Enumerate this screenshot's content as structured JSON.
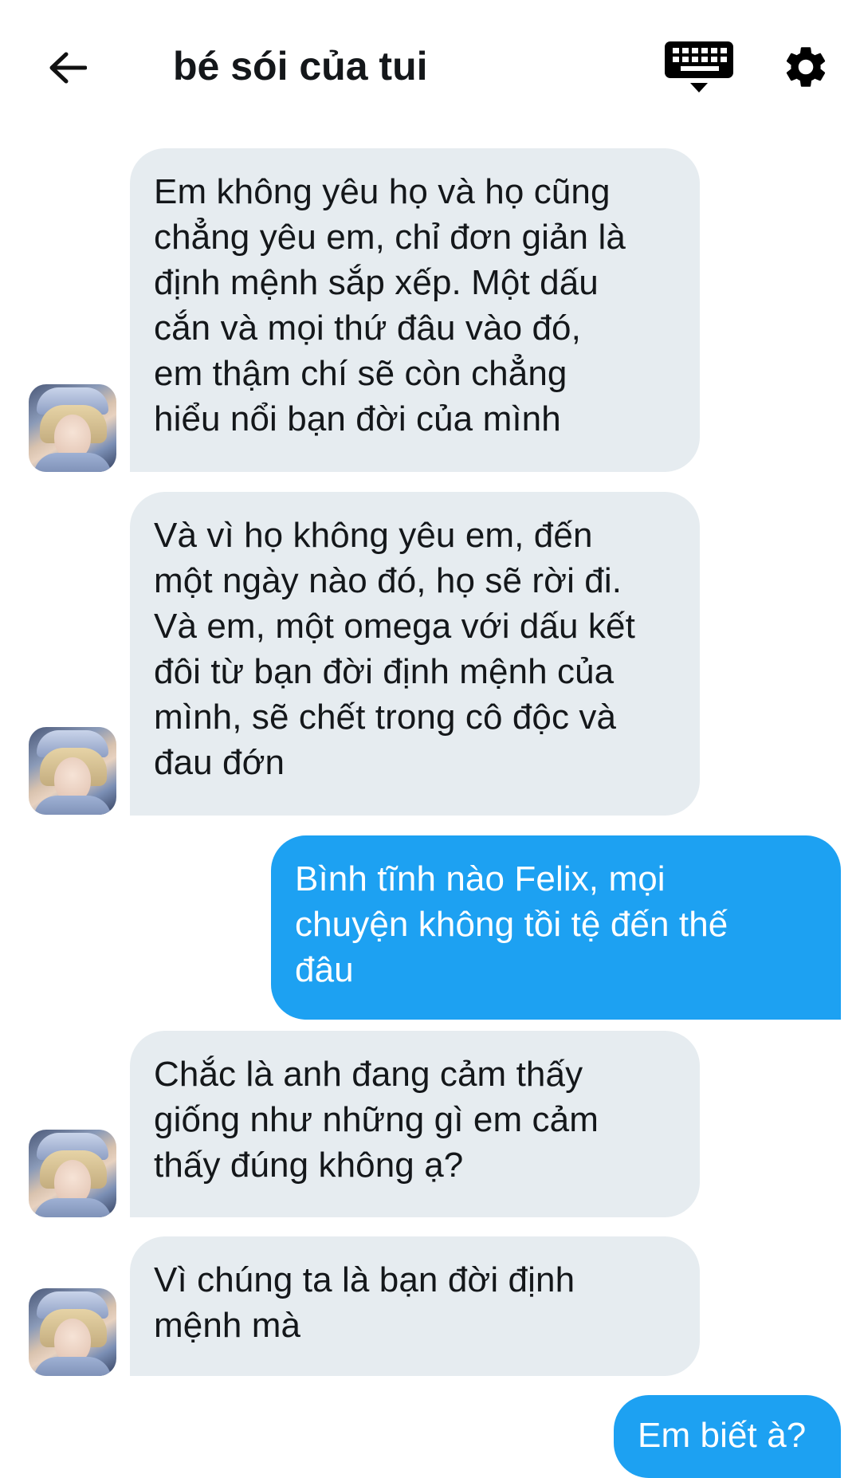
{
  "header": {
    "title": "bé sói của tui",
    "back_icon": "arrow-left-icon",
    "keyboard_icon": "keyboard-icon",
    "settings_icon": "gear-icon"
  },
  "colors": {
    "received_bubble": "#e6ecf0",
    "sent_bubble": "#1da1f2",
    "text_dark": "#14171a"
  },
  "messages": [
    {
      "sender": "other",
      "text": "Em không yêu họ và họ cũng\nchẳng yêu em, chỉ đơn giản là\nđịnh mệnh sắp xếp. Một dấu\ncắn và mọi thứ đâu vào đó,\nem thậm chí sẽ còn chẳng\nhiểu nổi bạn đời của mình"
    },
    {
      "sender": "other",
      "text": "Và vì họ không yêu em, đến\nmột ngày nào đó, họ sẽ rời đi.\nVà em, một omega với dấu kết\nđôi từ bạn đời định mệnh của\nmình, sẽ chết trong cô độc và\nđau đớn"
    },
    {
      "sender": "me",
      "text": "Bình tĩnh nào Felix, mọi\nchuyện không tồi tệ đến thế\nđâu"
    },
    {
      "sender": "other",
      "text": "Chắc là anh đang cảm thấy\ngiống như những gì em cảm\nthấy đúng không ạ?"
    },
    {
      "sender": "other",
      "text": "Vì chúng ta là bạn đời định\nmệnh mà"
    },
    {
      "sender": "me",
      "text": "Em biết à?"
    }
  ]
}
